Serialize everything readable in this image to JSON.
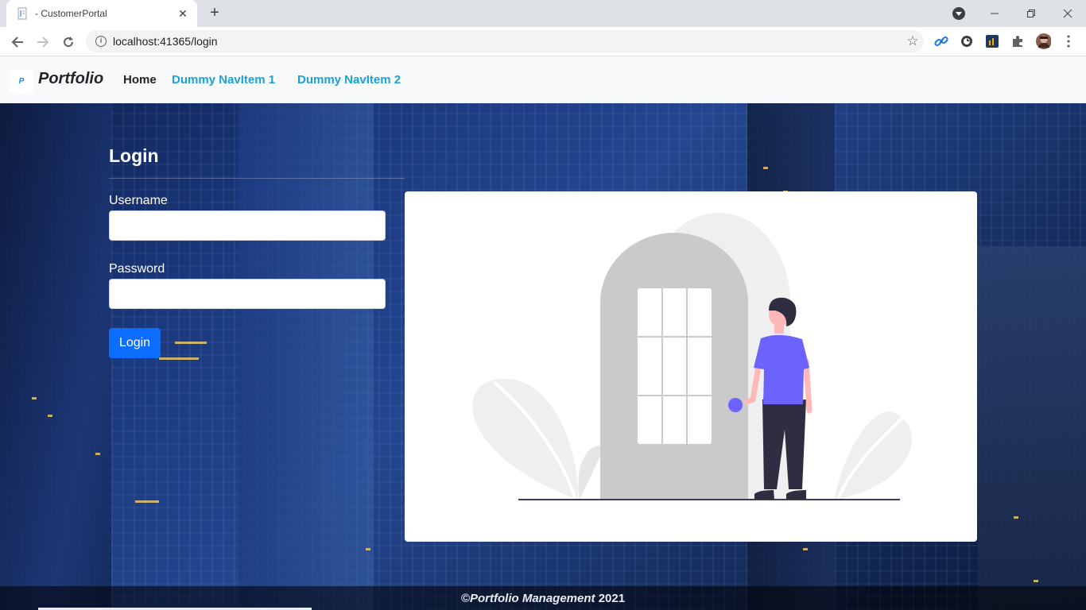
{
  "browser": {
    "tab_title": "- CustomerPortal",
    "url": "localhost:41365/login"
  },
  "navbar": {
    "brand": "Portfolio",
    "brand_logo_text": "P",
    "links": [
      "Home",
      "Dummy NavItem 1",
      "Dummy NavItem 2"
    ]
  },
  "login": {
    "title": "Login",
    "username_label": "Username",
    "username_value": "",
    "password_label": "Password",
    "password_value": "",
    "button_label": "Login"
  },
  "footer": {
    "copyright_prefix": "©",
    "company": "Portfolio Management",
    "year": "2021"
  },
  "colors": {
    "nav_link": "#17a2d8",
    "primary_button": "#0d6efd",
    "illustration_accent": "#6c63ff",
    "background": "#1b3a80"
  }
}
